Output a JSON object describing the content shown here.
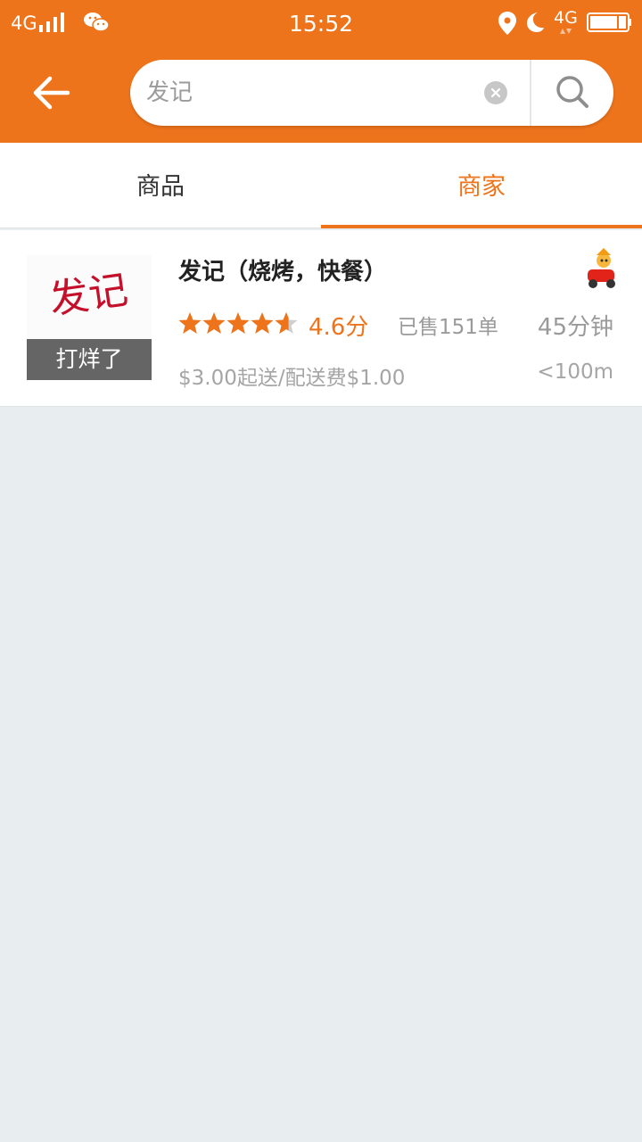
{
  "status_bar": {
    "network": "4G",
    "time": "15:52",
    "network_right": "4G"
  },
  "search": {
    "query": "发记",
    "placeholder": "发记"
  },
  "tabs": [
    {
      "label": "商品",
      "active": false
    },
    {
      "label": "商家",
      "active": true
    }
  ],
  "colors": {
    "accent": "#ee741b",
    "background": "#e8edf0"
  },
  "merchant": {
    "name": "发记（烧烤，快餐）",
    "logo_text": "发记",
    "closed_label": "打烊了",
    "rating_value": 4.6,
    "rating_max": 5,
    "rating_text": "4.6分",
    "sold": "已售151单",
    "delivery_time": "45分钟",
    "min_order": "$3.00起送/配送费$1.00",
    "distance": "<100m"
  }
}
